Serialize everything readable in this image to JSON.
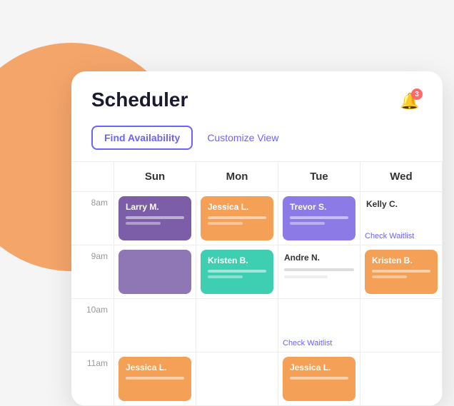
{
  "background": {},
  "card": {
    "title": "Scheduler",
    "notification_badge": "3",
    "toolbar": {
      "find_availability": "Find Availability",
      "customize_view": "Customize View"
    },
    "calendar": {
      "days": [
        "Sun",
        "Mon",
        "Tue",
        "Wed"
      ],
      "rows": [
        {
          "time": "8am",
          "cells": [
            {
              "name": "Larry M.",
              "color": "purple",
              "has_lines": true
            },
            {
              "name": "Jessica L.",
              "color": "orange",
              "has_lines": true
            },
            {
              "name": "Trevor S.",
              "color": "violet",
              "has_lines": true
            },
            {
              "name": "Kelly C.",
              "color": null,
              "has_lines": false,
              "check_waitlist": true
            }
          ]
        },
        {
          "time": "9am",
          "cells": [
            {
              "name": null,
              "color": "purple_cont",
              "has_lines": false
            },
            {
              "name": "Kristen B.",
              "color": "teal",
              "has_lines": true
            },
            {
              "name": "Andre N.",
              "color": "light_gray",
              "has_lines": false
            },
            {
              "name": "Kristen B.",
              "color": "orange",
              "has_lines": true
            }
          ]
        },
        {
          "time": "10am",
          "cells": [
            {
              "name": null,
              "color": null
            },
            {
              "name": null,
              "color": null
            },
            {
              "name": null,
              "color": null,
              "check_waitlist": true
            },
            {
              "name": null,
              "color": null
            }
          ]
        },
        {
          "time": "11am",
          "cells": [
            {
              "name": "Jessica L.",
              "color": "orange",
              "has_lines": true
            },
            {
              "name": null,
              "color": null
            },
            {
              "name": "Jessica L.",
              "color": "orange",
              "has_lines": true
            },
            {
              "name": null,
              "color": null
            }
          ]
        }
      ]
    }
  }
}
